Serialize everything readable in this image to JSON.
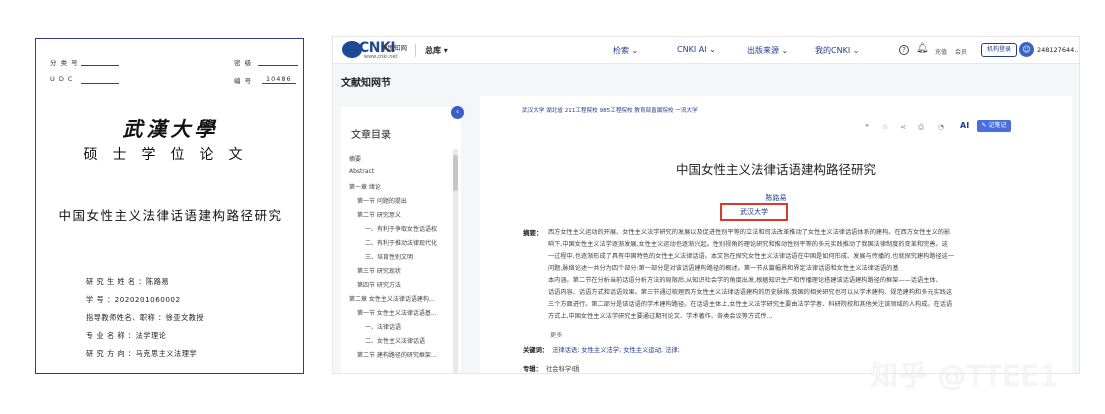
{
  "cover": {
    "class_no_label": "分 类 号",
    "secret_label": "密 级",
    "udc_label": "U D C",
    "serial_label": "编 号",
    "serial_value": "10486",
    "university": "武漢大學",
    "degree": "硕士学位论文",
    "title": "中国女性主义法律话语建构路径研究",
    "info": [
      "研 究 生 姓 名 ：陈路易",
      "学          号 ：2020201060002",
      "指导教师姓名、职称 ：徐亚文教授",
      "专  业  名  称 ：法学理论",
      "研  究  方  向 ：马克思主义法理学"
    ]
  },
  "cnki": {
    "logo_text": "CNKI",
    "logo_sub": "www.cnki.net",
    "logo_ch": "中国知网",
    "library": "总库",
    "nav": [
      "检索",
      "CNKI AI",
      "出版来源",
      "我的CNKI"
    ],
    "recharge": "充值",
    "member": "会员",
    "inst_login": "机构登录",
    "user_id": "248127644...",
    "page_heading": "文献知网节",
    "toc": {
      "title": "文章目录",
      "items": [
        "摘要",
        "Abstract",
        "第一章 绪论",
        "第一节 问题的提出",
        "第二节 研究意义",
        "一、有利于争取女性话语权",
        "二、有利于推动法律现代化",
        "三、培育性别文明",
        "第三节 研究现状",
        "第四节 研究方法",
        "第二章 女性主义法律话语建构...",
        "第一节 女性主义法律话语基...",
        "一、法律话语",
        "二、女性主义法律话语",
        "第二节 建构路径的研究框架..."
      ]
    },
    "article": {
      "source": "武汉大学  湖北省 211工程院校 985工程院校 教育部直属院校 一流大学",
      "ai_label": "AI",
      "note_button": "记笔记",
      "title": "中国女性主义法律话语建构路径研究",
      "author": "陈路易",
      "affiliation": "武汉大学",
      "abstract_label": "摘要：",
      "abstract_lines": [
        "西方女性主义运动的开展、女性主义法学研究的发展以及促进性别平等的立法和司法改革推动了女性主义法律话语体系的建构。在西方女性主义的影",
        "响下,中国女性主义法学逐渐发展,女性主义运动也逐渐兴起。性别视角的理论研究和推动性别平等的多元实践推动了我国法律制度的变革和完善。这",
        "一过程中,也逐渐形成了具有中国特色的女性主义法律话语。本文旨在探究女性主义法律话语在中国是如何形成、发展与传播的,也就探究建构路径这一",
        "问题,脉络论述一共分为四个部分:第一部分是对该话语建构路径的概述。第一节从篇幅界和界定法律话语和女性主义法律话语的基",
        "本内涵。第二节在分析当前话语分析方法的局限后,从知识社会学的角度出发,根据知识生产和传播理论搭建该话语建构路径的框架——话语主体、",
        "话语内容、话语方式和话语效果。第三节通过梳理西方女性主义法律话语建构的历史脉络,我国的相关研究也可以从学术建构、规范建构和多元实践这",
        "三个方面进行。第二部分是该话语的学术建构路径。在话语主体上,女性主义法学研究主要由法学学者、科研院校和其他关注该领域的人构成。在话语",
        "方式上,中国女性主义法学研究主要通过期刊论文、学术著作、各类会议等方式传..."
      ],
      "more": "更多",
      "keywords_label": "关键词：",
      "keywords": "法律话语;  女性主义法学;  女性主义运动;  法律;",
      "topic_label": "专辑：",
      "topic": "社会科学Ⅰ辑"
    }
  },
  "watermark": "知乎 @TTEE1"
}
